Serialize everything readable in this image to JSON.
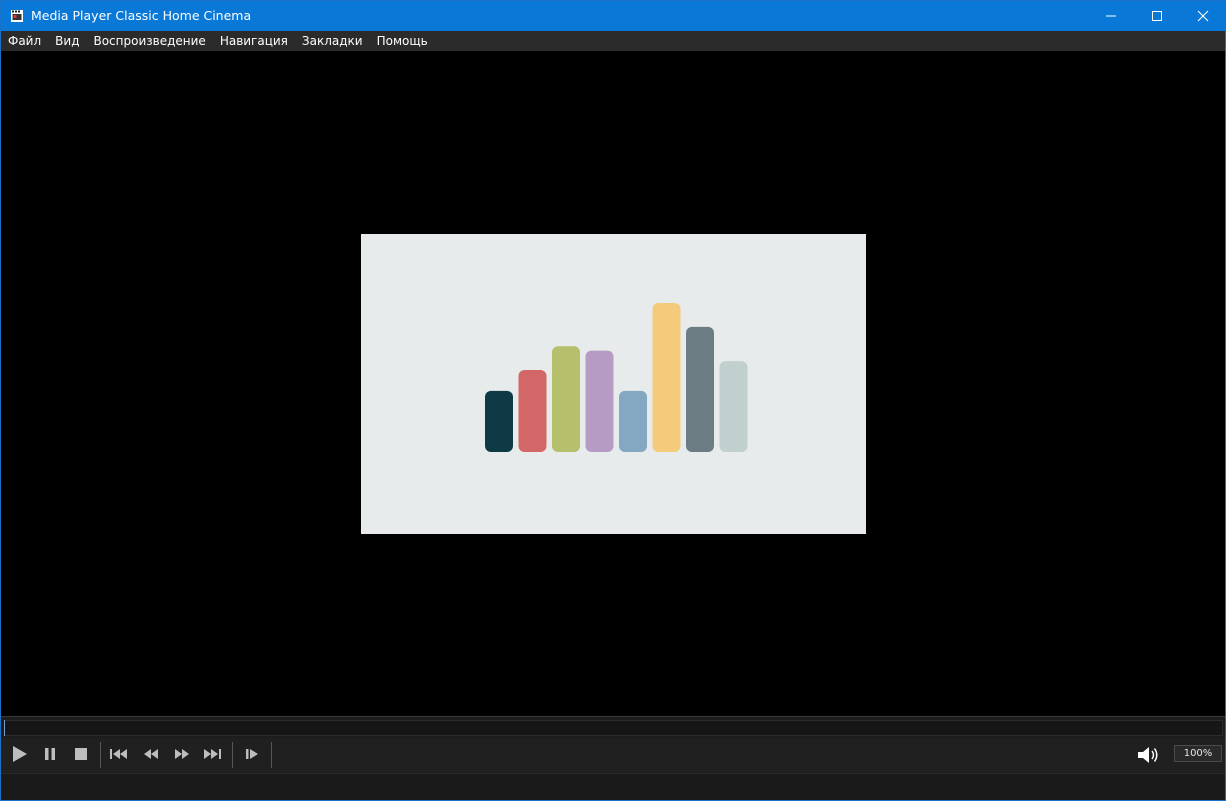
{
  "window": {
    "title": "Media Player Classic Home Cinema",
    "accent_color": "#0a78d7"
  },
  "title_buttons": {
    "minimize_icon": "minimize-icon",
    "maximize_icon": "maximize-icon",
    "close_icon": "close-icon"
  },
  "menu": {
    "items": [
      {
        "label": "Файл"
      },
      {
        "label": "Вид"
      },
      {
        "label": "Воспроизведение"
      },
      {
        "label": "Навигация"
      },
      {
        "label": "Закладки"
      },
      {
        "label": "Помощь"
      }
    ]
  },
  "video": {
    "background_color": "#e8ebeb",
    "bars": [
      {
        "color": "#0e3a45",
        "height": 0.41
      },
      {
        "color": "#d36767",
        "height": 0.55
      },
      {
        "color": "#b6bf6b",
        "height": 0.71
      },
      {
        "color": "#b69bc4",
        "height": 0.68
      },
      {
        "color": "#84a7c2",
        "height": 0.41
      },
      {
        "color": "#f3cb7b",
        "height": 1.0
      },
      {
        "color": "#6b7c82",
        "height": 0.84
      },
      {
        "color": "#c1cfce",
        "height": 0.61
      }
    ]
  },
  "seek": {
    "progress": 0
  },
  "controls": {
    "icons": [
      "play-icon",
      "pause-icon",
      "stop-icon",
      "skip-back-icon",
      "rewind-icon",
      "fast-forward-icon",
      "skip-forward-icon",
      "frame-step-icon",
      "volume-icon"
    ],
    "volume_label": "100%"
  }
}
